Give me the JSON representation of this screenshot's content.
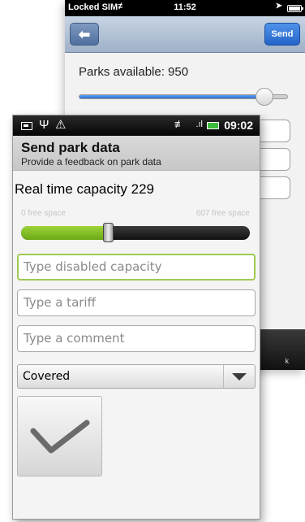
{
  "back_screen": {
    "status": {
      "carrier": "Locked SIM",
      "time": "11:52"
    },
    "nav": {
      "back_label": "⬅",
      "send_label": "Send"
    },
    "parks_available": "Parks available: 950",
    "slider_fraction": 0.89,
    "tabbar_peek": "k"
  },
  "front_screen": {
    "status": {
      "time": "09:02"
    },
    "header": {
      "title": "Send park data",
      "subtitle": "Provide a feedback on park data"
    },
    "capacity_label": "Real time capacity 229",
    "seek": {
      "min_label": "0 free space",
      "max_label": "607 free space",
      "fraction": 0.38
    },
    "inputs": {
      "disabled_capacity_placeholder": "Type disabled capacity",
      "tariff_placeholder": "Type a tariff",
      "comment_placeholder": "Type a comment"
    },
    "spinner": {
      "selected": "Covered"
    },
    "colors": {
      "seek_fill": "#8bc53f",
      "send_blue": "#2f78db"
    }
  }
}
